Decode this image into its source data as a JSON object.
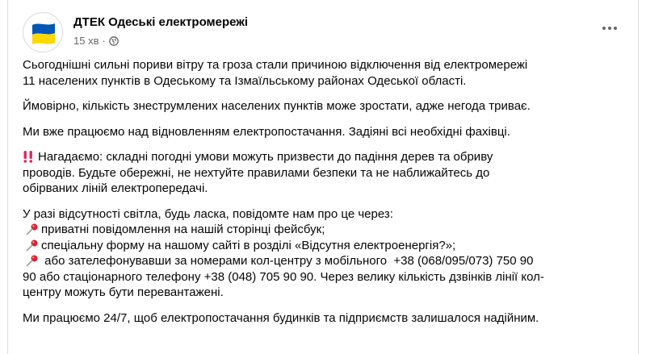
{
  "post": {
    "page_name": "ДТЕК Одеські електромережі",
    "time": "15 хв",
    "dot": "·",
    "paragraphs": {
      "p1": [
        "Сьогоднішні сильні пориви вітру та гроза стали причиною відключення від електромережі",
        "11 населених пунктів в Одеському та Ізмаїльському районах Одеської області."
      ],
      "p2": "Ймовірно, кількість знеструмлених населених пунктів може зростати, адже негода триває.",
      "p3": "Ми вже працюємо над відновленням електропостачання. Задіяні всі необхідні фахівці.",
      "p4": [
        "Нагадаємо: складні погодні умови можуть призвести до падіння дерев та обриву",
        "проводів. Будьте обережні, не нехтуйте правилами безпеки та не наближайтесь до",
        "обірваних ліній електропередачі."
      ],
      "p5_intro": "У разі відсутності світла, будь ласка, повідомте нам про це через:",
      "p5_items": [
        "приватні повідомлення на нашій сторінці фейсбук;",
        "спеціальну форму на нашому сайті в розділі «Відсутня електроенергія?»;",
        " або зателефонувавши за номерами кол-центру з мобільного  +38 (068/095/073) 750 90"
      ],
      "p5_cont": [
        "90 або стаціонарного телефону +38 (048) 705 90 90. Через велику кількість дзвінків лінії кол-",
        "центру можуть бути перевантажені."
      ],
      "p6": "Ми працюємо 24/7, щоб електропостачання будинків та підприємств залишалося надійним."
    }
  },
  "colors": {
    "flag_blue": "#0057b7",
    "flag_yellow": "#ffd700",
    "warn_red": "#e0245e",
    "pin_red": "#e02030"
  }
}
